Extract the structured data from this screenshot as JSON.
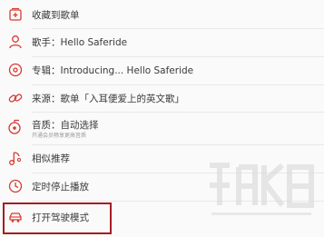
{
  "menu": {
    "items": [
      {
        "icon": "add-to-playlist-icon",
        "label": "收藏到歌单"
      },
      {
        "icon": "artist-icon",
        "label": "歌手：Hello Saferide"
      },
      {
        "icon": "album-icon",
        "label": "专辑：Introducing... Hello Saferide"
      },
      {
        "icon": "link-icon",
        "label": "来源：歌单「入耳便爱上的英文歌」"
      },
      {
        "icon": "quality-icon",
        "label": "音质：自动选择",
        "sublabel": "开通会员畅享更高音质"
      },
      {
        "icon": "music-note-icon",
        "label": "相似推荐"
      },
      {
        "icon": "timer-icon",
        "label": "定时停止播放"
      },
      {
        "icon": "car-icon",
        "label": "打开驾驶模式"
      }
    ]
  },
  "colors": {
    "accent": "#d43c33",
    "highlight_border": "#a51d23",
    "text": "#3a3a3a"
  }
}
